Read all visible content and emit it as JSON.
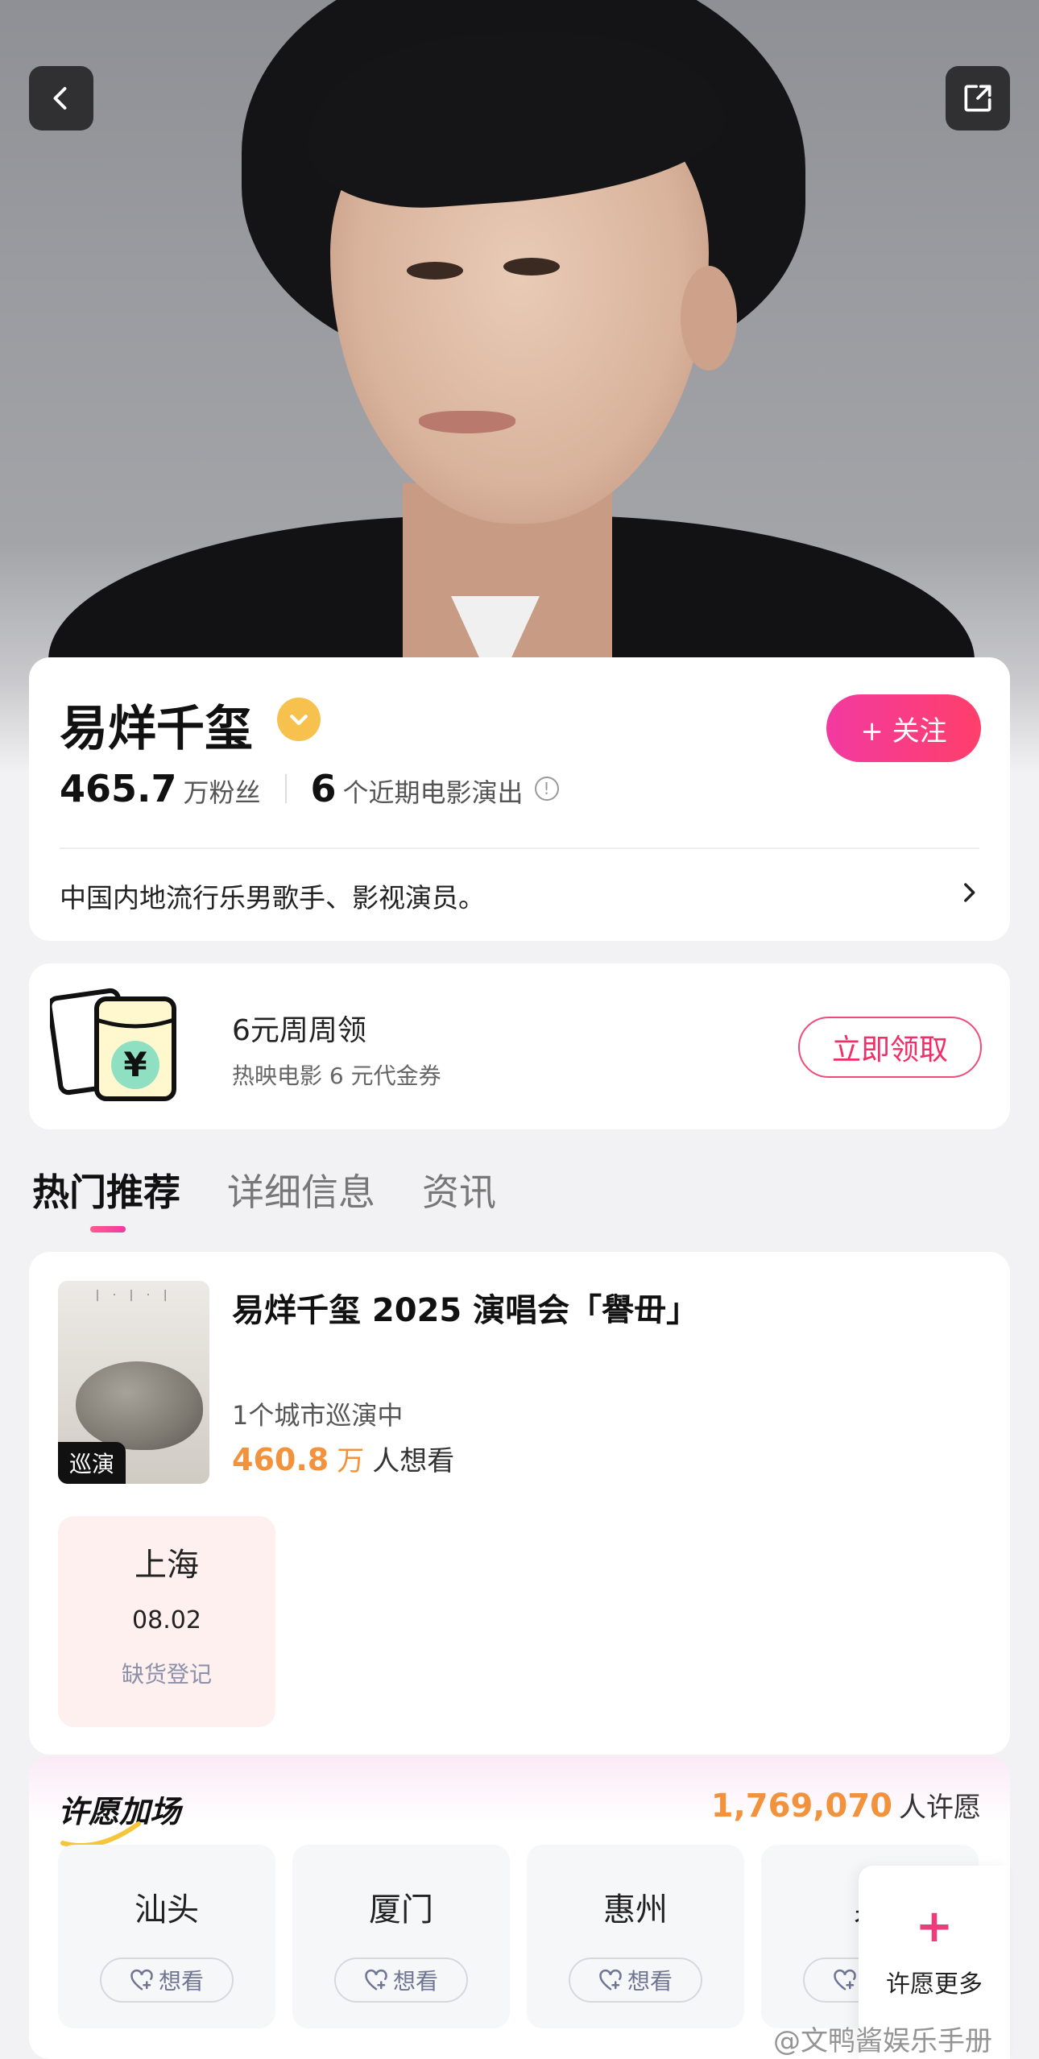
{
  "hero": {
    "back_icon": "chevron-left-icon",
    "share_icon": "share-icon"
  },
  "profile": {
    "name": "易烊千玺",
    "verified_icon": "verified-badge-icon",
    "follow_label": "+ 关注",
    "fans_num": "465.7",
    "fans_unit": "万粉丝",
    "shows_num": "6",
    "shows_label": "个近期电影演出",
    "bio": "中国内地流行乐男歌手、影视演员。"
  },
  "coupon": {
    "title": "6元周周领",
    "subtitle": "热映电影 6 元代金券",
    "claim_label": "立即领取"
  },
  "tabs": [
    {
      "label": "热门推荐",
      "active": true
    },
    {
      "label": "详细信息",
      "active": false
    },
    {
      "label": "资讯",
      "active": false
    }
  ],
  "event": {
    "badge": "巡演",
    "title": "易烊千玺 2025 演唱会「譽毌」",
    "cities": "1个城市巡演中",
    "wants_num": "460.8",
    "wants_unit": "万",
    "wants_label": "人想看",
    "date_city": "上海",
    "date_day": "08.02",
    "date_status": "缺货登记"
  },
  "wish": {
    "title": "许愿加场",
    "count": "1,769,070",
    "count_label": "人许愿",
    "cities": [
      {
        "name": "汕头",
        "want": "想看"
      },
      {
        "name": "厦门",
        "want": "想看"
      },
      {
        "name": "惠州",
        "want": "想看"
      },
      {
        "name": "泉",
        "want": "想看"
      }
    ],
    "more_label": "许愿更多"
  },
  "watermark": "@文鸭酱娱乐手册",
  "colors": {
    "accent_pink": "#f23aa0",
    "accent_orange": "#f2923c",
    "verified_gold": "#f6c14d"
  }
}
